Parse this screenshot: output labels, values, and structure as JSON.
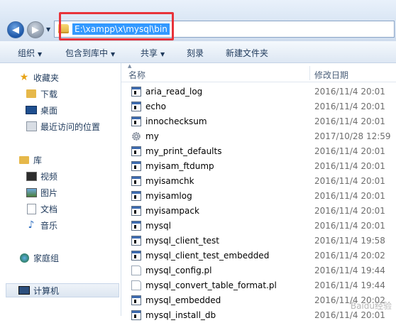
{
  "address": {
    "path": "E:\\xampp\\x\\mysql\\bin"
  },
  "toolbar": {
    "organize": "组织",
    "include_library": "包含到库中",
    "share": "共享",
    "burn": "刻录",
    "new_folder": "新建文件夹"
  },
  "nav": {
    "favorites": "收藏夹",
    "downloads": "下载",
    "desktop": "桌面",
    "recent": "最近访问的位置",
    "libraries": "库",
    "videos": "视频",
    "pictures": "图片",
    "documents": "文档",
    "music": "音乐",
    "homegroup": "家庭组",
    "computer": "计算机"
  },
  "columns": {
    "name": "名称",
    "date": "修改日期"
  },
  "files": [
    {
      "name": "aria_read_log",
      "date": "2016/11/4 20:01",
      "icon": "exe"
    },
    {
      "name": "echo",
      "date": "2016/11/4 20:01",
      "icon": "exe"
    },
    {
      "name": "innochecksum",
      "date": "2016/11/4 20:01",
      "icon": "exe"
    },
    {
      "name": "my",
      "date": "2017/10/28 12:59",
      "icon": "gear"
    },
    {
      "name": "my_print_defaults",
      "date": "2016/11/4 20:01",
      "icon": "exe"
    },
    {
      "name": "myisam_ftdump",
      "date": "2016/11/4 20:01",
      "icon": "exe"
    },
    {
      "name": "myisamchk",
      "date": "2016/11/4 20:01",
      "icon": "exe"
    },
    {
      "name": "myisamlog",
      "date": "2016/11/4 20:01",
      "icon": "exe"
    },
    {
      "name": "myisampack",
      "date": "2016/11/4 20:01",
      "icon": "exe"
    },
    {
      "name": "mysql",
      "date": "2016/11/4 20:01",
      "icon": "exe"
    },
    {
      "name": "mysql_client_test",
      "date": "2016/11/4 19:58",
      "icon": "exe"
    },
    {
      "name": "mysql_client_test_embedded",
      "date": "2016/11/4 20:02",
      "icon": "exe"
    },
    {
      "name": "mysql_config.pl",
      "date": "2016/11/4 19:44",
      "icon": "doc"
    },
    {
      "name": "mysql_convert_table_format.pl",
      "date": "2016/11/4 19:44",
      "icon": "doc"
    },
    {
      "name": "mysql_embedded",
      "date": "2016/11/4 20:02",
      "icon": "exe"
    },
    {
      "name": "mysql_install_db",
      "date": "2016/11/4 20:01",
      "icon": "exe"
    }
  ],
  "colors": {
    "selection": "#3399ff",
    "highlight": "#e8323a"
  }
}
